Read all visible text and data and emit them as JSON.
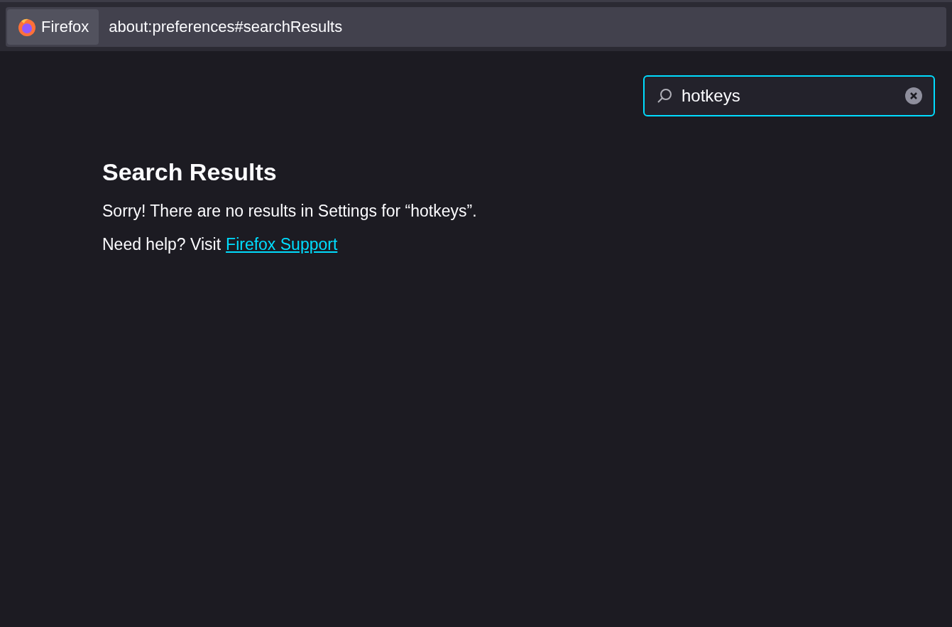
{
  "address_bar": {
    "identity_label": "Firefox",
    "url": "about:preferences#searchResults"
  },
  "search": {
    "value": "hotkeys",
    "focused": true
  },
  "results": {
    "heading": "Search Results",
    "message": "Sorry! There are no results in Settings for “hotkeys”.",
    "help_text": "Need help? Visit",
    "help_link": "Firefox Support"
  }
}
